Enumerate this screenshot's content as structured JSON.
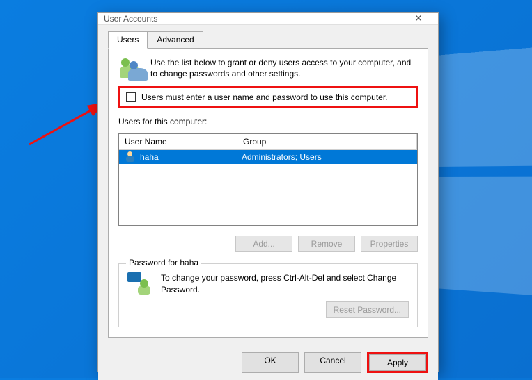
{
  "window": {
    "title": "User Accounts"
  },
  "tabs": {
    "users": "Users",
    "advanced": "Advanced"
  },
  "intro": "Use the list below to grant or deny users access to your computer, and to change passwords and other settings.",
  "checkbox_label": "Users must enter a user name and password to use this computer.",
  "list_label": "Users for this computer:",
  "columns": {
    "name": "User Name",
    "group": "Group"
  },
  "rows": [
    {
      "name": "haha",
      "group": "Administrators; Users"
    }
  ],
  "buttons": {
    "add": "Add...",
    "remove": "Remove",
    "properties": "Properties",
    "reset_pw": "Reset Password...",
    "ok": "OK",
    "cancel": "Cancel",
    "apply": "Apply"
  },
  "password_group": {
    "legend": "Password for haha",
    "text": "To change your password, press Ctrl-Alt-Del and select Change Password."
  }
}
